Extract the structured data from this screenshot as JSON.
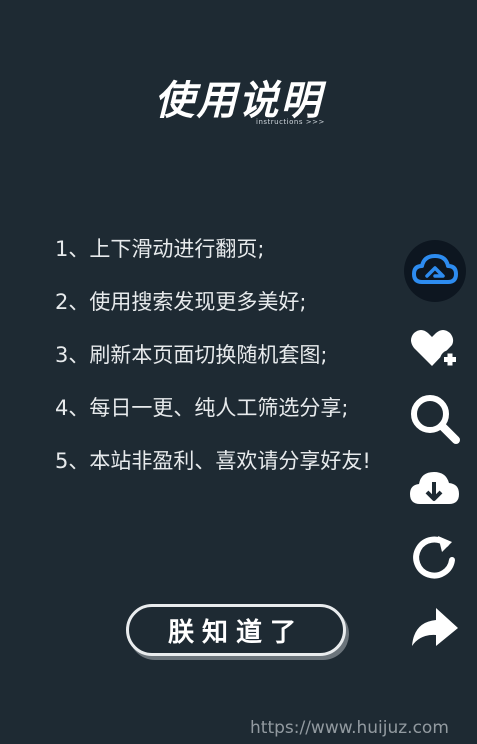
{
  "header": {
    "title": "使用说明",
    "subtitle": "instructions >>>"
  },
  "instructions": [
    "1、上下滑动进行翻页;",
    "2、使用搜索发现更多美好;",
    "3、刷新本页面切换随机套图;",
    "4、每日一更、纯人工筛选分享;",
    "5、本站非盈利、喜欢请分享好友!"
  ],
  "ok_button": {
    "label": "朕知道了"
  },
  "side_icons": [
    "cloud-logo-icon",
    "heart-plus-icon",
    "search-icon",
    "cloud-download-icon",
    "refresh-icon",
    "share-icon"
  ],
  "colors": {
    "background": "#1e2a33",
    "text": "#ffffff",
    "logo_blue": "#2d8cf0"
  },
  "watermark": "https://www.huijuz.com"
}
